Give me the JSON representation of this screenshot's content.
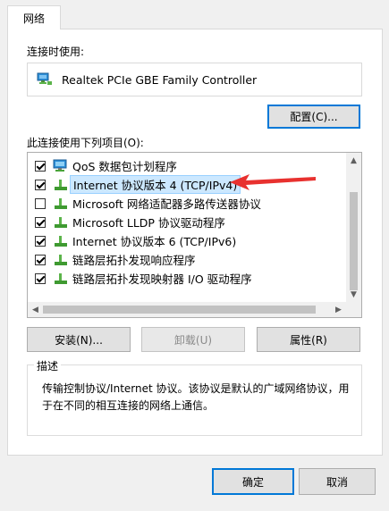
{
  "tab": {
    "label": "网络"
  },
  "connect_using": {
    "label": "连接时使用:",
    "adapter_name": "Realtek PCIe GBE Family Controller"
  },
  "configure_button": {
    "label": "配置(C)..."
  },
  "items_label": "此连接使用下列项目(O):",
  "items": [
    {
      "label": "QoS 数据包计划程序",
      "checked": true,
      "icon": "qos-scheduler-icon"
    },
    {
      "label": "Internet 协议版本 4 (TCP/IPv4)",
      "checked": true,
      "selected": true,
      "icon": "protocol-icon"
    },
    {
      "label": "Microsoft 网络适配器多路传送器协议",
      "checked": false,
      "icon": "protocol-icon"
    },
    {
      "label": "Microsoft LLDP 协议驱动程序",
      "checked": true,
      "icon": "protocol-icon"
    },
    {
      "label": "Internet 协议版本 6 (TCP/IPv6)",
      "checked": true,
      "icon": "protocol-icon"
    },
    {
      "label": "链路层拓扑发现响应程序",
      "checked": true,
      "icon": "protocol-icon"
    },
    {
      "label": "链路层拓扑发现映射器 I/O 驱动程序",
      "checked": true,
      "icon": "protocol-icon"
    }
  ],
  "buttons": {
    "install": "安装(N)...",
    "uninstall": "卸载(U)",
    "properties": "属性(R)"
  },
  "description": {
    "title": "描述",
    "text": "传输控制协议/Internet 协议。该协议是默认的广域网络协议，用于在不同的相互连接的网络上通信。"
  },
  "dialog": {
    "ok": "确定",
    "cancel": "取消"
  },
  "colors": {
    "accent": "#0078d7",
    "selection": "#cce8ff",
    "annotation_arrow": "#e8312f"
  }
}
